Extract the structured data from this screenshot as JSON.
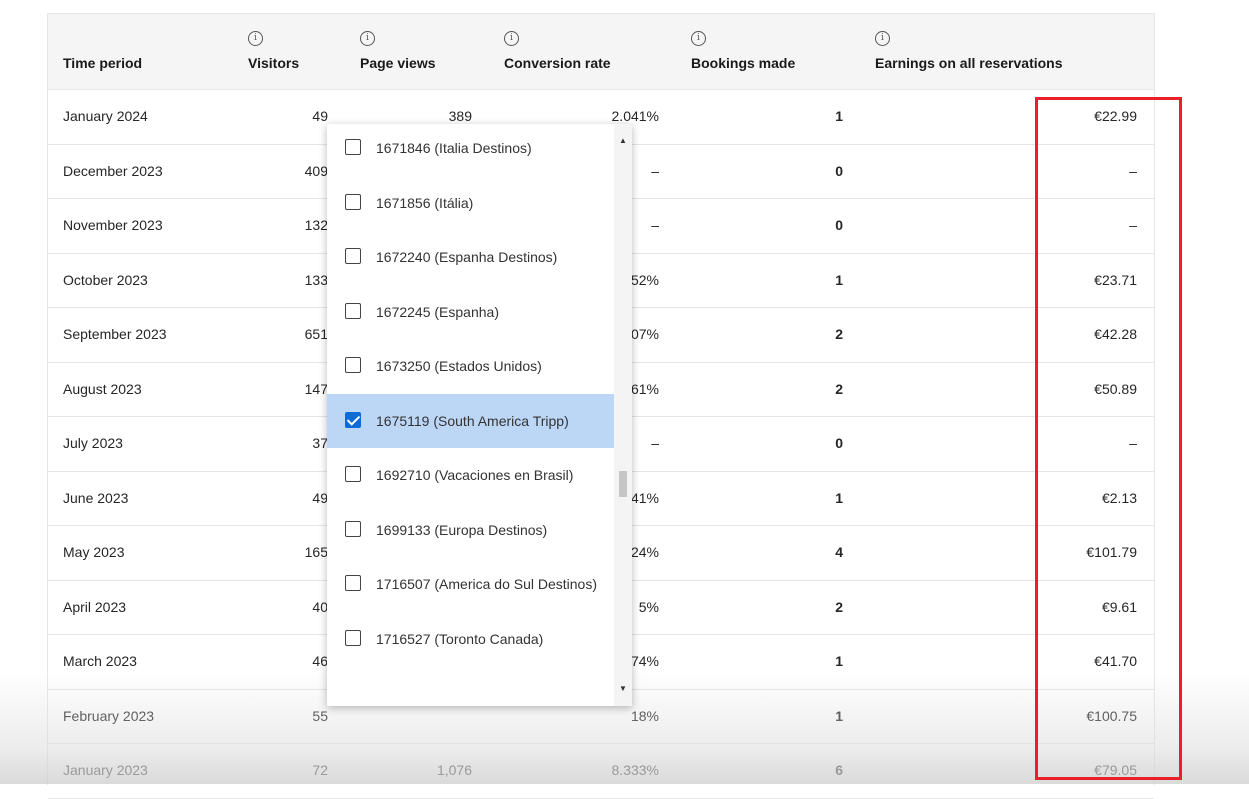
{
  "headers": {
    "time_period": "Time period",
    "visitors": "Visitors",
    "page_views": "Page views",
    "conversion_rate": "Conversion rate",
    "bookings_made": "Bookings made",
    "earnings": "Earnings on all reservations",
    "info_glyph": "i"
  },
  "rows": [
    {
      "period": "January 2024",
      "visitors": "49",
      "views": "389",
      "conv": "2.041%",
      "bookings": "1",
      "earnings": "€22.99"
    },
    {
      "period": "December 2023",
      "visitors": "409",
      "views": "",
      "conv": "–",
      "bookings": "0",
      "earnings": "–"
    },
    {
      "period": "November 2023",
      "visitors": "132",
      "views": "",
      "conv": "–",
      "bookings": "0",
      "earnings": "–"
    },
    {
      "period": "October 2023",
      "visitors": "133",
      "views": "",
      "conv": "52%",
      "bookings": "1",
      "earnings": "€23.71"
    },
    {
      "period": "September 2023",
      "visitors": "651",
      "views": "",
      "conv": "07%",
      "bookings": "2",
      "earnings": "€42.28"
    },
    {
      "period": "August 2023",
      "visitors": "147",
      "views": "",
      "conv": "61%",
      "bookings": "2",
      "earnings": "€50.89"
    },
    {
      "period": "July 2023",
      "visitors": "37",
      "views": "",
      "conv": "–",
      "bookings": "0",
      "earnings": "–"
    },
    {
      "period": "June 2023",
      "visitors": "49",
      "views": "",
      "conv": "41%",
      "bookings": "1",
      "earnings": "€2.13"
    },
    {
      "period": "May 2023",
      "visitors": "165",
      "views": "",
      "conv": "24%",
      "bookings": "4",
      "earnings": "€101.79"
    },
    {
      "period": "April 2023",
      "visitors": "40",
      "views": "",
      "conv": "5%",
      "bookings": "2",
      "earnings": "€9.61"
    },
    {
      "period": "March 2023",
      "visitors": "46",
      "views": "",
      "conv": "74%",
      "bookings": "1",
      "earnings": "€41.70"
    },
    {
      "period": "February 2023",
      "visitors": "55",
      "views": "",
      "conv": "18%",
      "bookings": "1",
      "earnings": "€100.75"
    },
    {
      "period": "January 2023",
      "visitors": "72",
      "views": "1,076",
      "conv": "8.333%",
      "bookings": "6",
      "earnings": "€79.05"
    }
  ],
  "dropdown": {
    "options": [
      {
        "label": "1671846 (Italia Destinos)",
        "checked": false
      },
      {
        "label": "1671856 (Itália)",
        "checked": false
      },
      {
        "label": "1672240 (Espanha Destinos)",
        "checked": false
      },
      {
        "label": "1672245 (Espanha)",
        "checked": false
      },
      {
        "label": "1673250 (Estados Unidos)",
        "checked": false
      },
      {
        "label": "1675119 (South America Tripp)",
        "checked": true
      },
      {
        "label": "1692710 (Vacaciones en Brasil)",
        "checked": false
      },
      {
        "label": "1699133 (Europa Destinos)",
        "checked": false
      },
      {
        "label": "1716507 (America do Sul Destinos)",
        "checked": false
      },
      {
        "label": "1716527 (Toronto Canada)",
        "checked": false
      }
    ],
    "scroll_up_glyph": "▲",
    "scroll_down_glyph": "▼"
  },
  "colors": {
    "selected_bg": "#bcd6f6",
    "checkbox_checked": "#0c6bd6",
    "highlight_border": "#e8202a",
    "header_bg": "#f5f5f5"
  }
}
